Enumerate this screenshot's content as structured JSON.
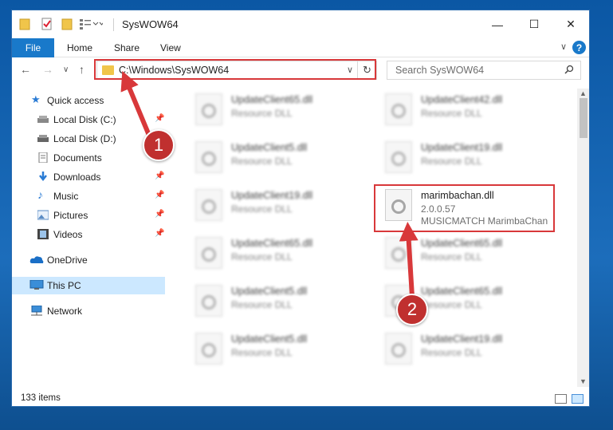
{
  "window": {
    "title": "SysWOW64",
    "controls": {
      "minimize": "—",
      "maximize": "☐",
      "close": "✕"
    }
  },
  "ribbon": {
    "tabs": [
      "File",
      "Home",
      "Share",
      "View"
    ],
    "help": "?"
  },
  "nav": {
    "address": "C:\\Windows\\SysWOW64",
    "search_placeholder": "Search SysWOW64"
  },
  "sidebar": {
    "items": [
      {
        "label": "Quick access",
        "icon": "star-icon",
        "pinned": false
      },
      {
        "label": "Local Disk (C:)",
        "icon": "drive-icon",
        "pinned": true
      },
      {
        "label": "Local Disk (D:)",
        "icon": "drive-icon",
        "pinned": false
      },
      {
        "label": "Documents",
        "icon": "documents-icon",
        "pinned": true
      },
      {
        "label": "Downloads",
        "icon": "download-icon",
        "pinned": true
      },
      {
        "label": "Music",
        "icon": "music-icon",
        "pinned": true
      },
      {
        "label": "Pictures",
        "icon": "pictures-icon",
        "pinned": true
      },
      {
        "label": "Videos",
        "icon": "videos-icon",
        "pinned": true
      },
      {
        "label": "OneDrive",
        "icon": "cloud-icon",
        "pinned": false
      },
      {
        "label": "This PC",
        "icon": "computer-icon",
        "pinned": false,
        "selected": true
      },
      {
        "label": "Network",
        "icon": "network-icon",
        "pinned": false
      }
    ]
  },
  "files": {
    "left": [
      {
        "name": "UpdateClient65.dll",
        "type": "Resource DLL"
      },
      {
        "name": "UpdateClient5.dll",
        "type": "Resource DLL"
      },
      {
        "name": "UpdateClient19.dll",
        "type": "Resource DLL"
      },
      {
        "name": "UpdateClient65.dll",
        "type": "Resource DLL"
      },
      {
        "name": "UpdateClient5.dll",
        "type": "Resource DLL"
      },
      {
        "name": "UpdateClient5.dll",
        "type": "Resource DLL"
      }
    ],
    "right": [
      {
        "name": "UpdateClient42.dll",
        "type": "Resource DLL"
      },
      {
        "name": "UpdateClient19.dll",
        "type": "Resource DLL"
      },
      {
        "name": "marimbachan.dll",
        "version": "2.0.0.57",
        "description": "MUSICMATCH MarimbaChan",
        "highlighted": true
      },
      {
        "name": "UpdateClient65.dll",
        "type": "Resource DLL"
      },
      {
        "name": "UpdateClient65.dll",
        "type": "Resource DLL"
      },
      {
        "name": "UpdateClient19.dll",
        "type": "Resource DLL"
      }
    ]
  },
  "status": {
    "item_count": "133 items"
  },
  "annotations": {
    "step1": "1",
    "step2": "2",
    "color": "#c0302f"
  }
}
